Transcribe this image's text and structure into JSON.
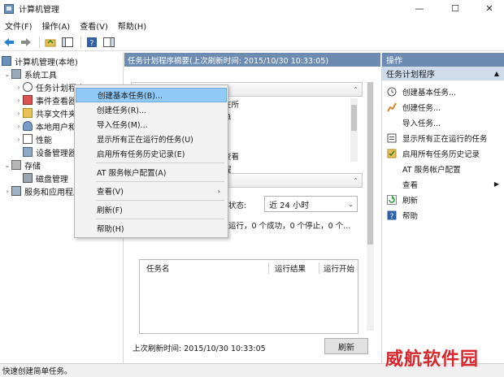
{
  "window": {
    "title": "计算机管理"
  },
  "window_controls": {
    "minimize": "—",
    "maximize": "☐",
    "close": "✕"
  },
  "menu": [
    "文件(F)",
    "操作(A)",
    "查看(V)",
    "帮助(H)"
  ],
  "tree": {
    "root": "计算机管理(本地)",
    "items": [
      {
        "label": "系统工具",
        "icon": "tools-icon"
      },
      {
        "label": "任务计划程序",
        "icon": "clock-icon"
      },
      {
        "label": "事件查看器",
        "icon": "event-viewer-icon"
      },
      {
        "label": "共享文件夹",
        "icon": "shared-folder-icon"
      },
      {
        "label": "本地用户和组",
        "icon": "users-icon"
      },
      {
        "label": "性能",
        "icon": "performance-icon"
      },
      {
        "label": "设备管理器",
        "icon": "device-manager-icon"
      },
      {
        "label": "存储",
        "icon": "storage-icon"
      },
      {
        "label": "磁盘管理",
        "icon": "disk-icon"
      },
      {
        "label": "服务和应用程序",
        "icon": "services-icon"
      }
    ]
  },
  "center": {
    "header": "任务计划程序摘要(上次刷新时间: 2015/10/30 10:33:05)",
    "desc_lines": [
      "程序来创建和管理计算机将在所",
      "的常见任务。若要开始，请单",
      "的命令。",
      "",
      "划程序库的文件夹中。若要查看",
      "执行这操作，请在任务计划程"
    ],
    "status_label": "状态:",
    "status_select": "近 24 小时",
    "summary": "运行，0 个成功，0 个停止，0 个...",
    "table_headers": [
      "任务名",
      "运行结果",
      "运行开始"
    ],
    "last_refresh": "上次刷新时间: 2015/10/30 10:33:05",
    "refresh_button": "刷新"
  },
  "actions": {
    "header": "操作",
    "section": "任务计划程序",
    "items": [
      {
        "label": "创建基本任务...",
        "icon": "create-basic-task-icon"
      },
      {
        "label": "创建任务...",
        "icon": "create-task-icon"
      },
      {
        "label": "导入任务...",
        "icon": ""
      },
      {
        "label": "显示所有正在运行的任务",
        "icon": "running-tasks-icon"
      },
      {
        "label": "启用所有任务历史记录",
        "icon": "history-icon"
      },
      {
        "label": "AT 服务帐户配置",
        "icon": ""
      },
      {
        "label": "查看",
        "icon": ""
      },
      {
        "label": "刷新",
        "icon": "refresh-icon"
      },
      {
        "label": "帮助",
        "icon": "help-icon"
      }
    ]
  },
  "context_menu": {
    "items": [
      "创建基本任务(B)...",
      "创建任务(R)...",
      "导入任务(M)...",
      "显示所有正在运行的任务(U)",
      "启用所有任务历史记录(E)",
      "AT 服务帐户配置(A)",
      "查看(V)",
      "刷新(F)",
      "帮助(H)"
    ]
  },
  "statusbar": "快速创建简单任务。",
  "watermark": "威航软件园",
  "colors": {
    "pane_header": "#6d8bb0",
    "highlight": "#91c9f7",
    "watermark": "#d8262c"
  }
}
